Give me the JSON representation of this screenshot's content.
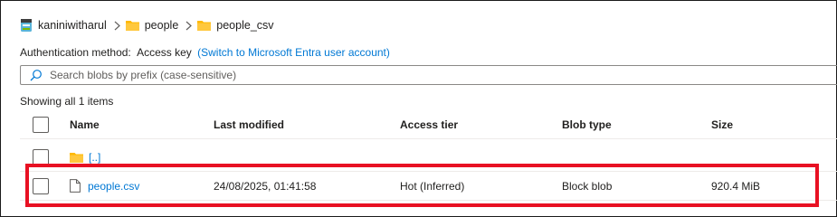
{
  "breadcrumb": {
    "items": [
      {
        "label": "kaniniwitharul",
        "icon": "storage-account-icon"
      },
      {
        "label": "people",
        "icon": "folder-icon"
      },
      {
        "label": "people_csv",
        "icon": "folder-icon"
      }
    ]
  },
  "auth": {
    "label": "Authentication method:",
    "value": "Access key",
    "link": "(Switch to Microsoft Entra user account)"
  },
  "search": {
    "placeholder": "Search blobs by prefix (case-sensitive)"
  },
  "status": {
    "showing": "Showing all 1 items"
  },
  "table": {
    "headers": {
      "name": "Name",
      "modified": "Last modified",
      "tier": "Access tier",
      "type": "Blob type",
      "size": "Size"
    },
    "parent_row": {
      "name": "[..]"
    },
    "rows": [
      {
        "name": "people.csv",
        "modified": "24/08/2025, 01:41:58",
        "tier": "Hot (Inferred)",
        "type": "Block blob",
        "size": "920.4 MiB"
      }
    ]
  },
  "colors": {
    "link": "#0078d4",
    "folder": "#ffb900",
    "highlight": "#e81123"
  }
}
